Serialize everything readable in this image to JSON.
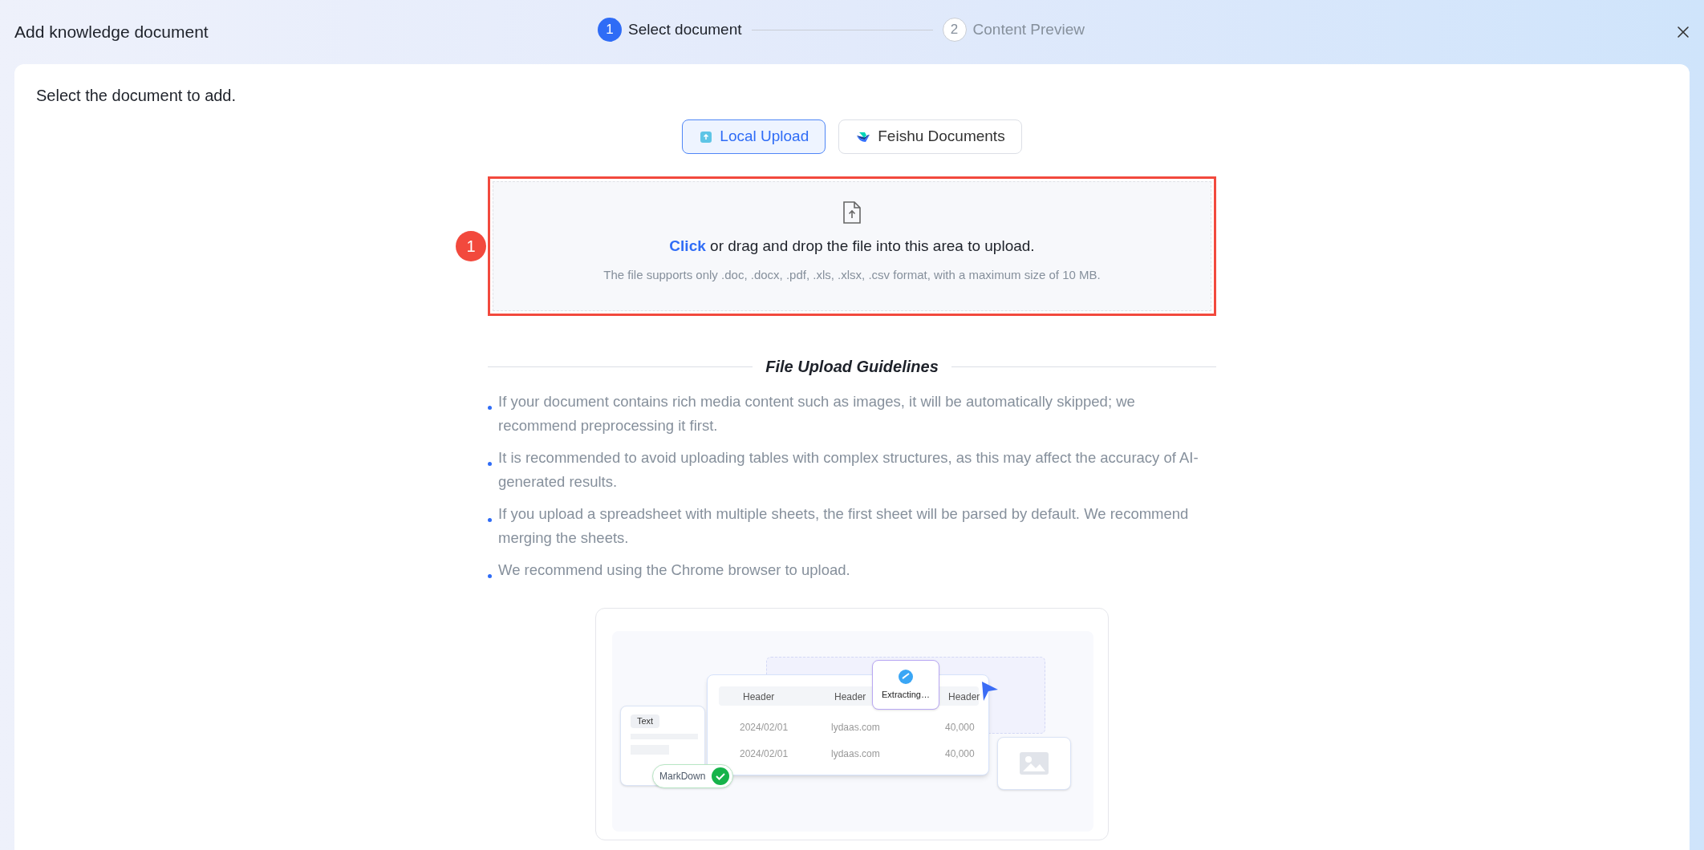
{
  "header": {
    "title": "Add knowledge document",
    "steps": [
      {
        "number": "1",
        "label": "Select document",
        "selected": true
      },
      {
        "number": "2",
        "label": "Content Preview",
        "selected": false
      }
    ]
  },
  "main": {
    "prompt": "Select the document to add.",
    "sources": [
      {
        "kind": "local",
        "label": "Local Upload",
        "selected": true
      },
      {
        "kind": "feishu",
        "label": "Feishu Documents",
        "selected": false
      }
    ],
    "upload": {
      "link": "Click",
      "text": "or drag and drop the file into this area to upload.",
      "hint": "The file supports only .doc, .docx, .pdf, .xls, .xlsx, .csv format, with a maximum size of 10 MB."
    },
    "annotation": {
      "number": "1"
    },
    "guidelines": {
      "title": "File Upload Guidelines",
      "items": [
        "If your document contains rich media content such as images, it will be automatically skipped; we recommend preprocessing it first.",
        "It is recommended to avoid uploading tables with complex structures, as this may affect the accuracy of AI-generated results.",
        "If you upload a spreadsheet with multiple sheets, the first sheet will be parsed by default. We recommend merging the sheets.",
        "We recommend using the Chrome browser to upload."
      ]
    },
    "illustration": {
      "table_headers": [
        "Header",
        "Header",
        "Header"
      ],
      "rows": [
        [
          "2024/02/01",
          "lydaas.com",
          "40,000"
        ],
        [
          "2024/02/01",
          "lydaas.com",
          "40,000"
        ]
      ],
      "text_label": "Text",
      "format_label": "MarkDown",
      "status": "Extracting…"
    }
  }
}
